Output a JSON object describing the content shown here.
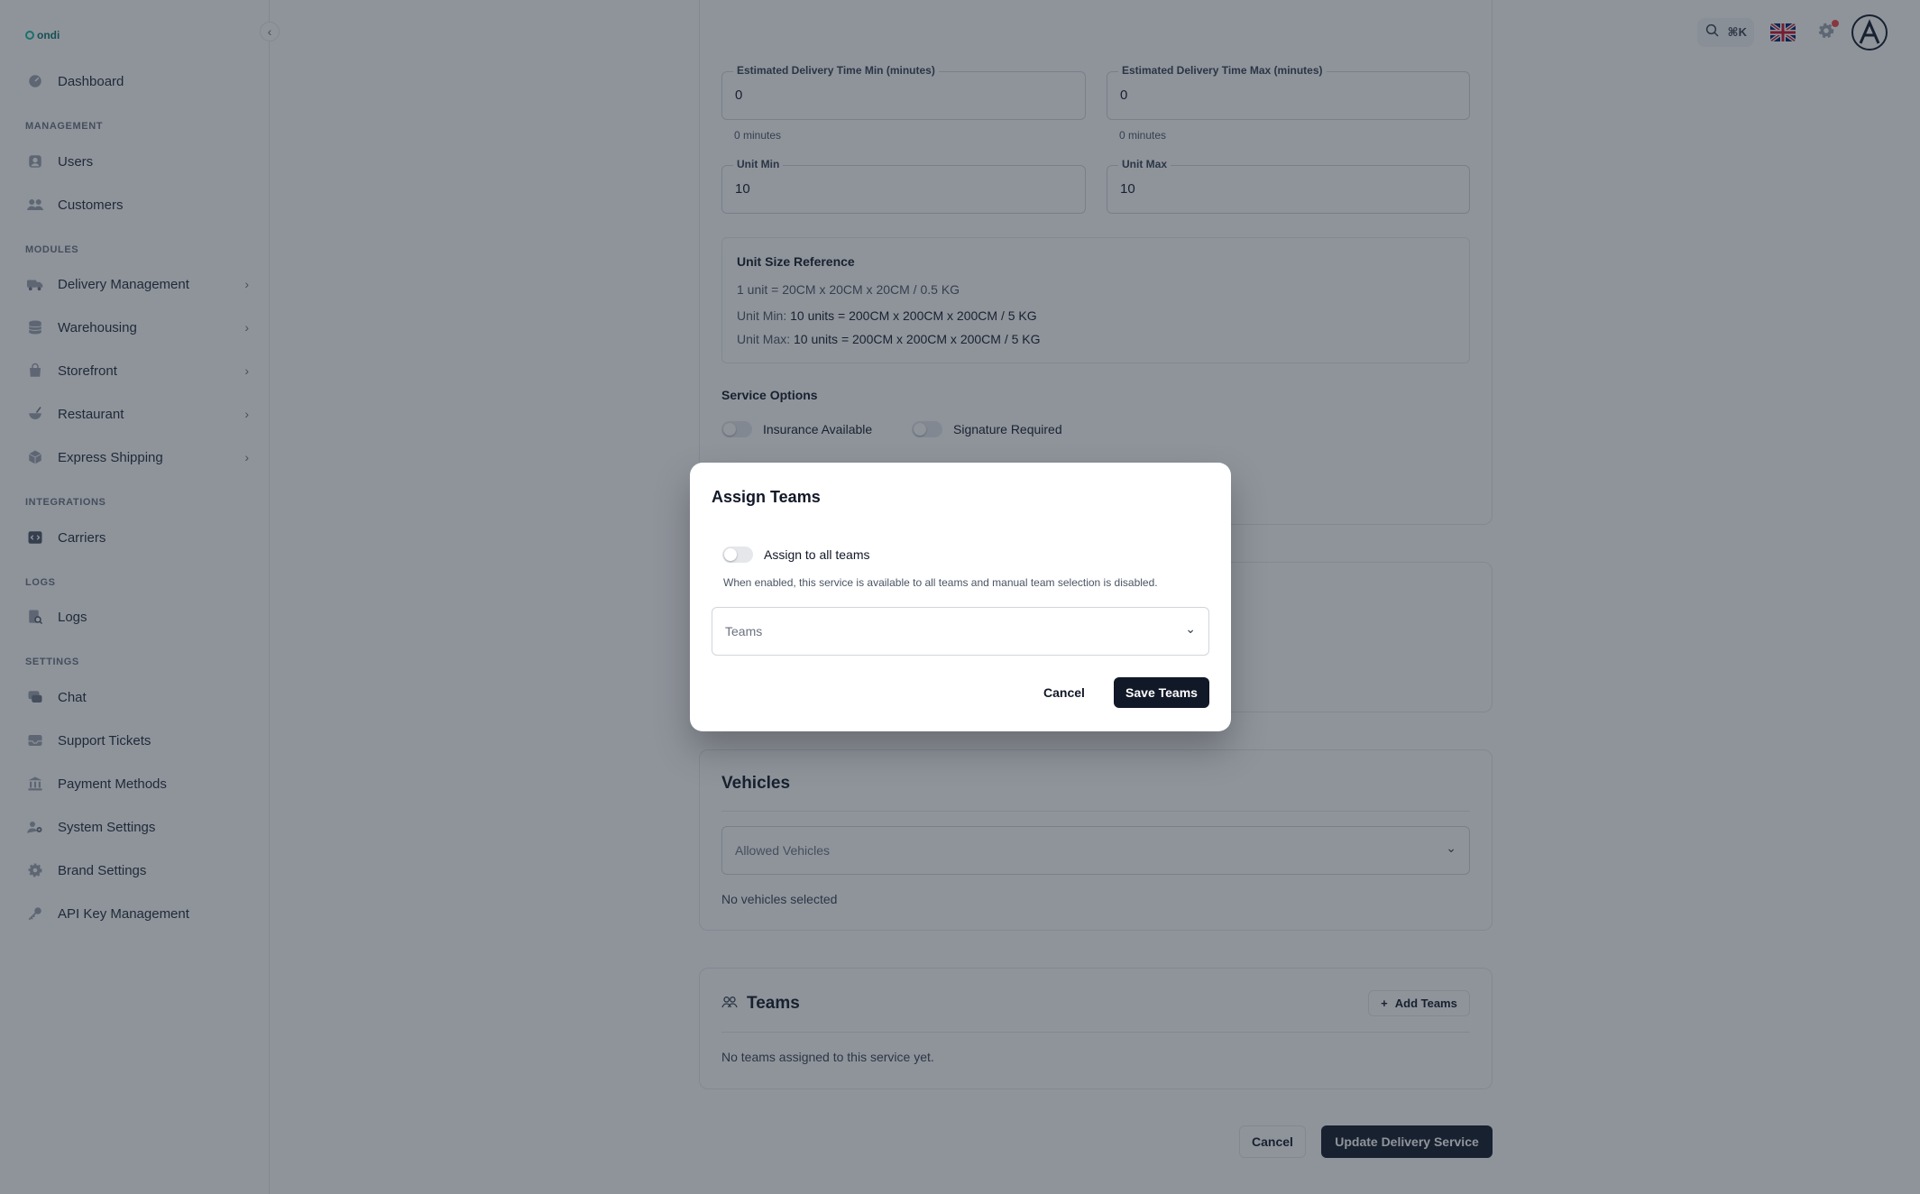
{
  "brand": {
    "logo_text": "ondi",
    "accent": "#14b8a6"
  },
  "sidebar": {
    "items": [
      {
        "label": "Dashboard",
        "icon": "dashboard-icon"
      }
    ],
    "sections": [
      {
        "title": "MANAGEMENT",
        "items": [
          {
            "label": "Users"
          },
          {
            "label": "Customers"
          }
        ]
      },
      {
        "title": "MODULES",
        "items": [
          {
            "label": "Delivery Management"
          },
          {
            "label": "Warehousing"
          },
          {
            "label": "Storefront"
          },
          {
            "label": "Restaurant"
          },
          {
            "label": "Express Shipping"
          }
        ]
      },
      {
        "title": "INTEGRATIONS",
        "items": [
          {
            "label": "Carriers"
          }
        ]
      },
      {
        "title": "LOGS",
        "items": [
          {
            "label": "Logs"
          }
        ]
      },
      {
        "title": "SETTINGS",
        "items": [
          {
            "label": "Chat"
          },
          {
            "label": "Support Tickets"
          },
          {
            "label": "Payment Methods"
          },
          {
            "label": "System Settings"
          },
          {
            "label": "Brand Settings"
          },
          {
            "label": "API Key Management"
          }
        ]
      }
    ]
  },
  "topbar": {
    "shortcut": "⌘K",
    "language": "English (UK)"
  },
  "form": {
    "eta_min": {
      "label": "Estimated Delivery Time Min (minutes)",
      "value": "0",
      "hint": "0 minutes"
    },
    "eta_max": {
      "label": "Estimated Delivery Time Max (minutes)",
      "value": "0",
      "hint": "0 minutes"
    },
    "unit_min": {
      "label": "Unit Min",
      "value": "10"
    },
    "unit_max": {
      "label": "Unit Max",
      "value": "10"
    },
    "unit_ref": {
      "title": "Unit Size Reference",
      "base": "1 unit = 20CM x 20CM x 20CM / 0.5 KG",
      "min_label": "Unit Min:",
      "min_value": "10 units = 200CM x 200CM x 200CM / 5 KG",
      "max_label": "Unit Max:",
      "max_value": "10 units = 200CM x 200CM x 200CM / 5 KG"
    },
    "service_options": {
      "title": "Service Options",
      "insurance": "Insurance Available",
      "signature": "Signature Required"
    },
    "vehicles": {
      "title": "Vehicles",
      "placeholder": "Allowed Vehicles",
      "empty": "No vehicles selected"
    },
    "teams": {
      "title": "Teams",
      "add_label": "Add Teams",
      "empty": "No teams assigned to this service yet."
    },
    "cancel_label": "Cancel",
    "submit_label": "Update Delivery Service"
  },
  "modal": {
    "title": "Assign Teams",
    "toggle_label": "Assign to all teams",
    "description": "When enabled, this service is available to all teams and manual team selection is disabled.",
    "select_placeholder": "Teams",
    "cancel_label": "Cancel",
    "save_label": "Save Teams"
  }
}
